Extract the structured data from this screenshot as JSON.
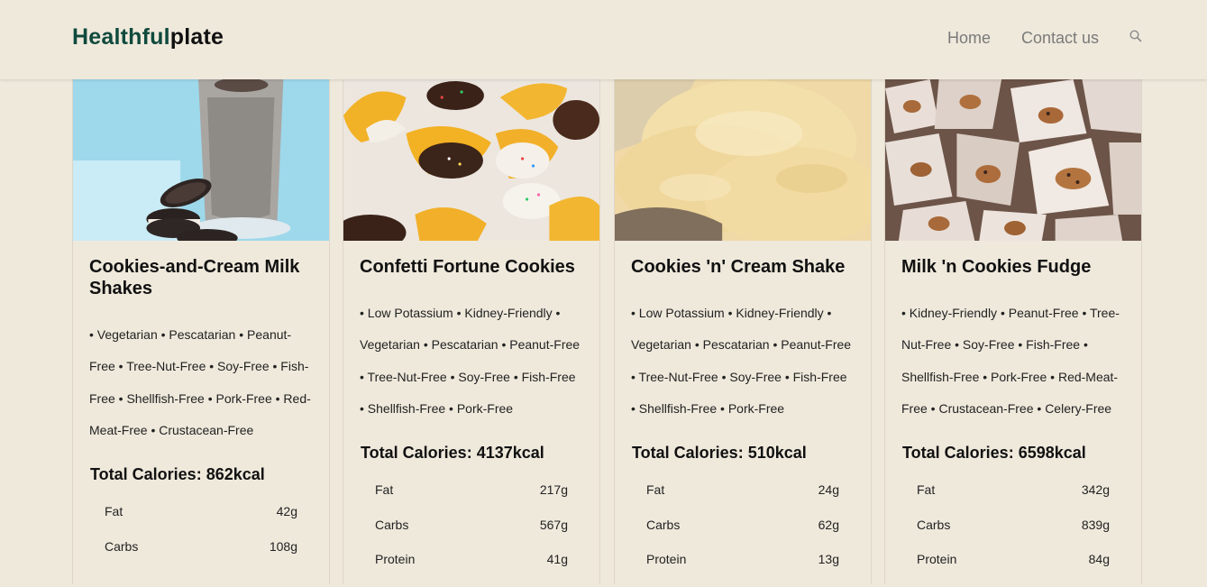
{
  "header": {
    "logo_part1": "Healthful",
    "logo_part2": "plate",
    "nav": {
      "home": "Home",
      "contact": "Contact us"
    },
    "search_icon": "search-icon"
  },
  "colors": {
    "background": "#efe9dc",
    "brand_green": "#0f4a3d",
    "nav_text": "#7a7a7a"
  },
  "cards": [
    {
      "title": "Cookies-and-Cream Milk Shakes",
      "image": "milkshake-photo",
      "tags": "• Vegetarian • Pescatarian • Peanut-Free • Tree-Nut-Free • Soy-Free • Fish-Free • Shellfish-Free • Pork-Free • Red-Meat-Free • Crustacean-Free",
      "calories": "Total Calories: 862kcal",
      "nutrients": [
        {
          "label": "Fat",
          "value": "42g"
        },
        {
          "label": "Carbs",
          "value": "108g"
        }
      ]
    },
    {
      "title": "Confetti Fortune Cookies",
      "image": "fortune-cookies-photo",
      "tags": "• Low Potassium • Kidney-Friendly • Vegetarian • Pescatarian • Peanut-Free • Tree-Nut-Free • Soy-Free • Fish-Free • Shellfish-Free • Pork-Free",
      "calories": "Total Calories: 4137kcal",
      "nutrients": [
        {
          "label": "Fat",
          "value": "217g"
        },
        {
          "label": "Carbs",
          "value": "567g"
        },
        {
          "label": "Protein",
          "value": "41g"
        }
      ]
    },
    {
      "title": "Cookies 'n' Cream Shake",
      "image": "ice-cream-photo",
      "tags": "• Low Potassium • Kidney-Friendly • Vegetarian • Pescatarian • Peanut-Free • Tree-Nut-Free • Soy-Free • Fish-Free • Shellfish-Free • Pork-Free",
      "calories": "Total Calories: 510kcal",
      "nutrients": [
        {
          "label": "Fat",
          "value": "24g"
        },
        {
          "label": "Carbs",
          "value": "62g"
        },
        {
          "label": "Protein",
          "value": "13g"
        }
      ]
    },
    {
      "title": "Milk 'n Cookies Fudge",
      "image": "fudge-photo",
      "tags": "• Kidney-Friendly • Peanut-Free • Tree-Nut-Free • Soy-Free • Fish-Free • Shellfish-Free • Pork-Free • Red-Meat-Free • Crustacean-Free • Celery-Free",
      "calories": "Total Calories: 6598kcal",
      "nutrients": [
        {
          "label": "Fat",
          "value": "342g"
        },
        {
          "label": "Carbs",
          "value": "839g"
        },
        {
          "label": "Protein",
          "value": "84g"
        }
      ]
    }
  ]
}
